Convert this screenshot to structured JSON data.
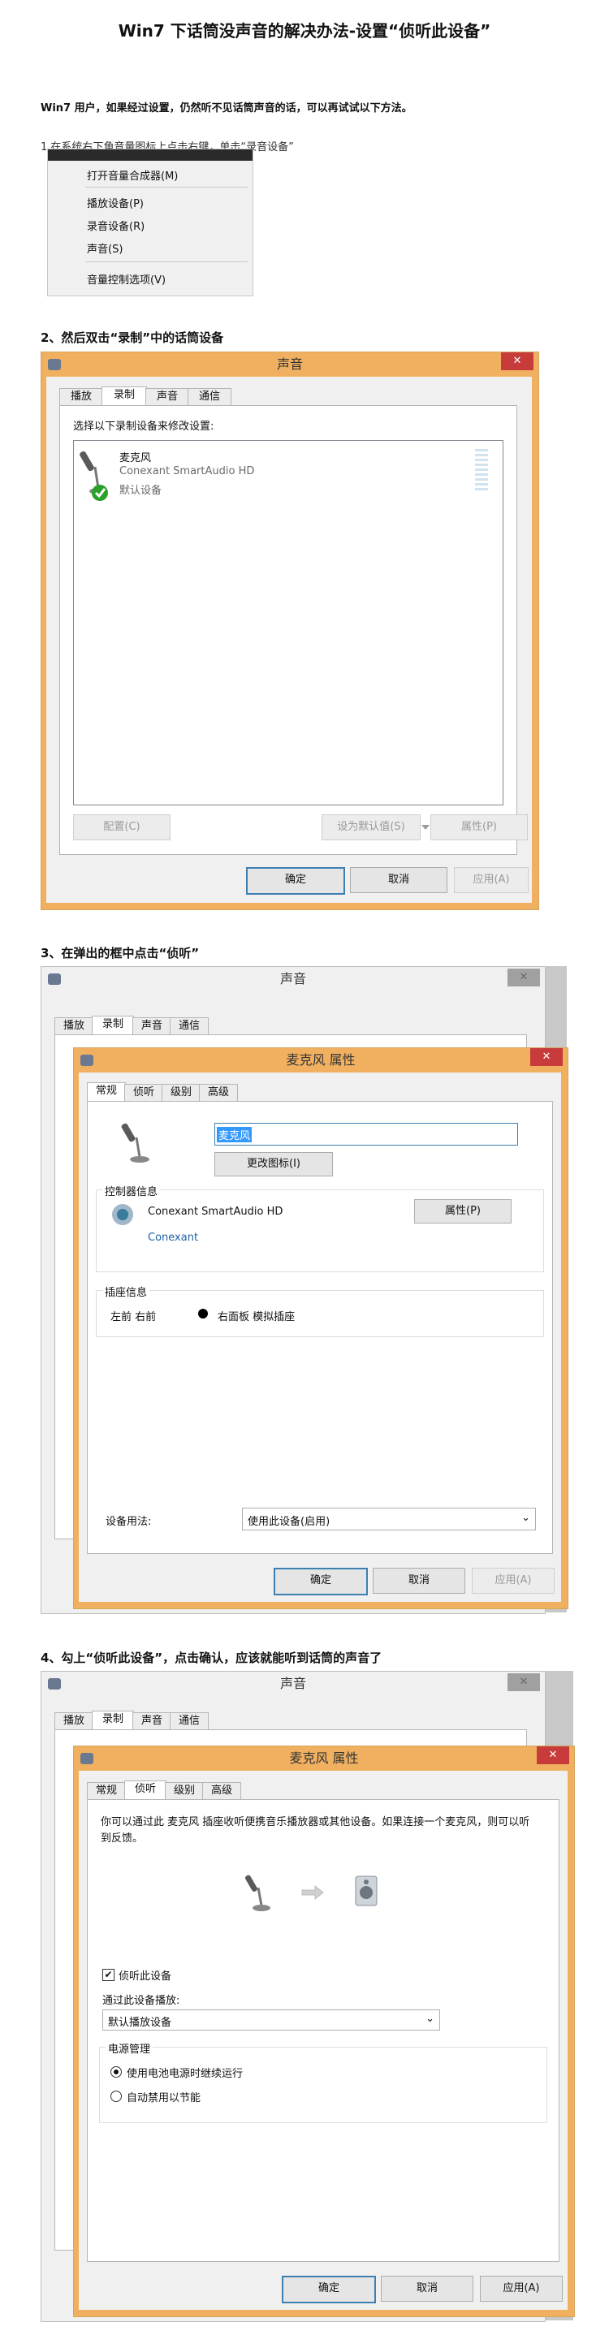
{
  "doc": {
    "title": "Win7 下话筒没声音的解决办法-设置“侦听此设备”",
    "intro": "Win7 用户，如果经过设置，仍然听不见话筒声音的话，可以再试试以下方法。",
    "step1": "1.在系统右下角音量图标上点击右键，单击“录音设备”",
    "step2": "2、然后双击“录制”中的话筒设备",
    "step3": "3、在弹出的框中点击“侦听”",
    "step4": "4、勾上“侦听此设备”，点击确认，应该就能听到话筒的声音了"
  },
  "context_menu": {
    "items": [
      "打开音量合成器(M)",
      "播放设备(P)",
      "录音设备(R)",
      "声音(S)",
      "音量控制选项(V)"
    ]
  },
  "sound_dialog": {
    "title": "声音",
    "close": "✕",
    "tabs": [
      "播放",
      "录制",
      "声音",
      "通信"
    ],
    "instruction": "选择以下录制设备来修改设置:",
    "device": {
      "name": "麦克风",
      "driver": "Conexant SmartAudio HD",
      "status": "默认设备"
    },
    "configure": "配置(C)",
    "set_default": "设为默认值(S)",
    "properties": "属性(P)",
    "ok": "确定",
    "cancel": "取消",
    "apply": "应用(A)"
  },
  "mic_props": {
    "title": "麦克风 属性",
    "close": "✕",
    "tabs": [
      "常规",
      "侦听",
      "级别",
      "高级"
    ],
    "name_value": "麦克风",
    "change_icon": "更改图标(I)",
    "controller_group": "控制器信息",
    "controller_name": "Conexant SmartAudio HD",
    "controller_vendor": "Conexant",
    "properties": "属性(P)",
    "jack_group": "插座信息",
    "jack_left": "左前 右前",
    "jack_desc": "右面板 模拟插座",
    "usage_label": "设备用法:",
    "usage_value": "使用此设备(启用)",
    "ok": "确定",
    "cancel": "取消",
    "apply": "应用(A)"
  },
  "listen_tab": {
    "description": "你可以通过此 麦克风 插座收听便携音乐播放器或其他设备。如果连接一个麦克风，则可以听到反馈。",
    "listen_checkbox": "侦听此设备",
    "listen_checked": true,
    "playback_label": "通过此设备播放:",
    "playback_value": "默认播放设备",
    "power_group": "电源管理",
    "power_opt1": "使用电池电源时继续运行",
    "power_opt2": "自动禁用以节能",
    "power_selected": 1
  },
  "colors": {
    "window_frame": "#f0b060",
    "close_red": "#c73b3b",
    "ok_border": "#3c7fb1",
    "check_green": "#2aa02a"
  }
}
